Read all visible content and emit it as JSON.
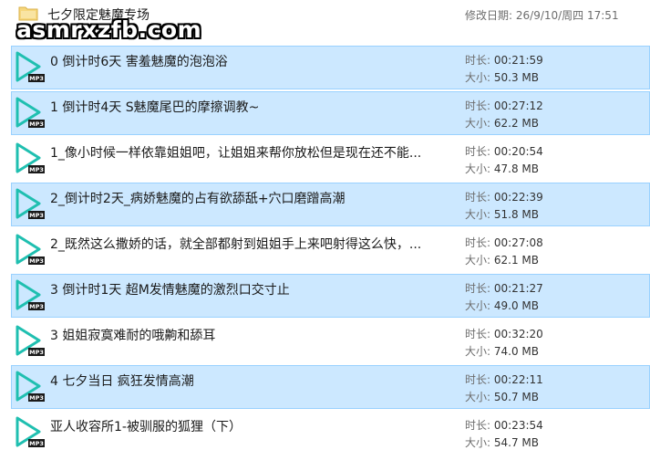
{
  "header": {
    "folder_name": "七夕限定魅魔专场",
    "modified_label": "修改日期:",
    "modified_value": "26/9/10/周四 17:51",
    "watermark": "asmrxzfb.com"
  },
  "labels": {
    "duration": "时长:",
    "size": "大小:",
    "badge": "MP3"
  },
  "colors": {
    "selected_bg": "#cce8ff",
    "selected_border": "#99d1ff",
    "play_icon": "#1fbfb0"
  },
  "files": [
    {
      "name": "0 倒计时6天 害羞魅魔的泡泡浴",
      "duration": "00:21:59",
      "size": "50.3 MB",
      "selected": true
    },
    {
      "name": "1 倒计时4天 S魅魔尾巴的摩擦调教~",
      "duration": "00:27:12",
      "size": "62.2 MB",
      "selected": true
    },
    {
      "name": "1_像小时候一样依靠姐姐吧，让姐姐来帮你放松但是现在还不能...",
      "duration": "00:20:54",
      "size": "47.8 MB",
      "selected": false
    },
    {
      "name": "2_倒计时2天_病娇魅魔的占有欲舔舐+穴口磨蹭高潮",
      "duration": "00:22:39",
      "size": "51.8 MB",
      "selected": true
    },
    {
      "name": "2_既然这么撒娇的话，就全部都射到姐姐手上来吧射得这么快，...",
      "duration": "00:27:08",
      "size": "62.1 MB",
      "selected": false
    },
    {
      "name": "3 倒计时1天 超M发情魅魔的激烈口交寸止",
      "duration": "00:21:27",
      "size": "49.0 MB",
      "selected": true
    },
    {
      "name": "3 姐姐寂寞难耐的哦齁和舔耳",
      "duration": "00:32:20",
      "size": "74.0 MB",
      "selected": false
    },
    {
      "name": "4 七夕当日 疯狂发情高潮",
      "duration": "00:22:11",
      "size": "50.7 MB",
      "selected": true
    },
    {
      "name": "亚人收容所1-被驯服的狐狸（下）",
      "duration": "00:23:54",
      "size": "54.7 MB",
      "selected": false
    }
  ]
}
